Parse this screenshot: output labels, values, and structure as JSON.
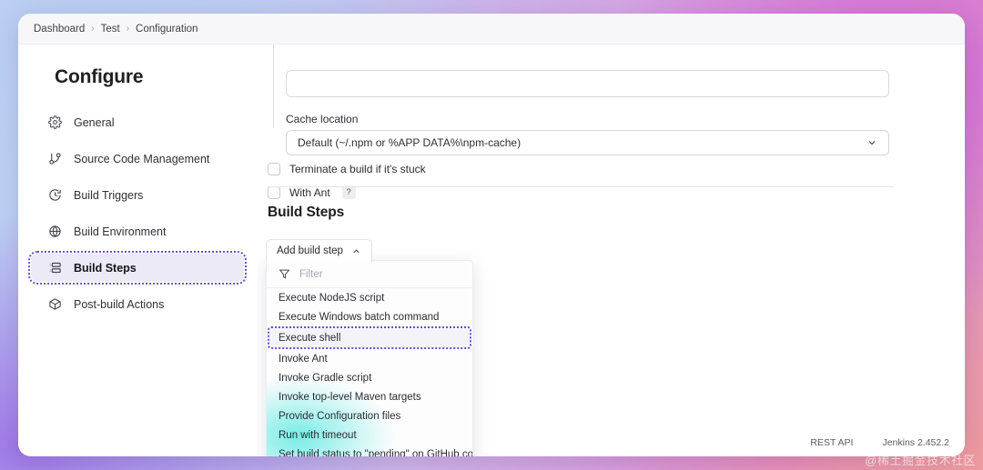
{
  "breadcrumb": {
    "items": [
      "Dashboard",
      "Test",
      "Configuration"
    ],
    "separator": "›"
  },
  "sidebar": {
    "title": "Configure",
    "items": [
      {
        "label": "General",
        "icon": "gear-icon"
      },
      {
        "label": "Source Code Management",
        "icon": "git-branch-icon"
      },
      {
        "label": "Build Triggers",
        "icon": "clock-icon"
      },
      {
        "label": "Build Environment",
        "icon": "globe-icon"
      },
      {
        "label": "Build Steps",
        "icon": "list-icon"
      },
      {
        "label": "Post-build Actions",
        "icon": "package-icon"
      }
    ],
    "active_index": 4
  },
  "form": {
    "cache_location_label": "Cache location",
    "cache_location_value": "Default (~/.npm or %APP DATA%\\npm-cache)",
    "terminate_label": "Terminate a build if it's stuck",
    "terminate_checked": false,
    "with_ant_label": "With Ant",
    "with_ant_checked": false,
    "help_badge": "?"
  },
  "build_steps": {
    "heading": "Build Steps",
    "add_button_label": "Add build step",
    "add_button_chevron": "⌃"
  },
  "dropdown": {
    "filter_placeholder": "Filter",
    "filter_value": "",
    "items": [
      "Execute NodeJS script",
      "Execute Windows batch command",
      "Execute shell",
      "Invoke Ant",
      "Invoke Gradle script",
      "Invoke top-level Maven targets",
      "Provide Configuration files",
      "Run with timeout",
      "Set build status to \"pending\" on GitHub commit"
    ],
    "focused_index": 2
  },
  "footer": {
    "rest_api": "REST API",
    "version": "Jenkins 2.452.2"
  },
  "watermark": "@稀土掘金技术社区",
  "colors": {
    "focus_outline": "#6b4fd8",
    "active_bg": "#eceaf6",
    "card_bg": "#ffffff"
  }
}
